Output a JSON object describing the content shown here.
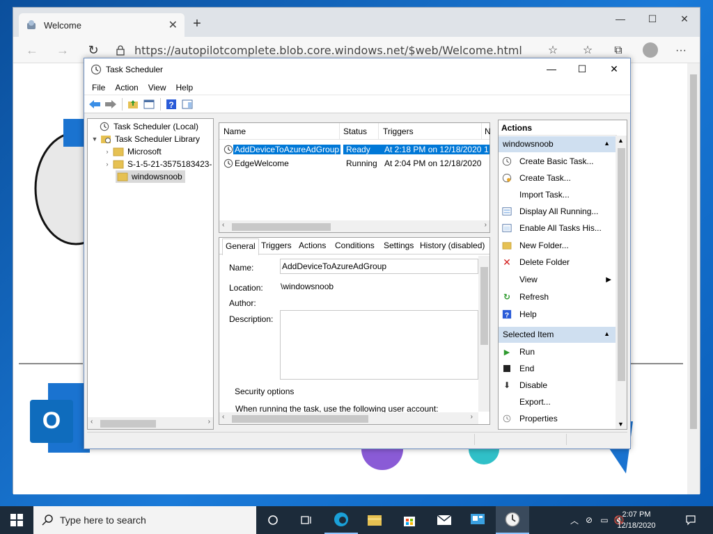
{
  "browser": {
    "tab_title": "Welcome",
    "url": "https://autopilotcomplete.blob.core.windows.net/$web/Welcome.html"
  },
  "task_scheduler": {
    "title": "Task Scheduler",
    "menu": [
      "File",
      "Action",
      "View",
      "Help"
    ],
    "tree": {
      "root": "Task Scheduler (Local)",
      "library": "Task Scheduler Library",
      "children": [
        "Microsoft",
        "S-1-5-21-3575183423-",
        "windowsnoob"
      ]
    },
    "task_list": {
      "columns": [
        "Name",
        "Status",
        "Triggers",
        "N"
      ],
      "rows": [
        {
          "name": "AddDeviceToAzureAdGroup",
          "status": "Ready",
          "trigger": "At 2:18 PM on 12/18/2020",
          "extra": "1"
        },
        {
          "name": "EdgeWelcome",
          "status": "Running",
          "trigger": "At 2:04 PM on 12/18/2020",
          "extra": ""
        }
      ]
    },
    "details": {
      "tabs": [
        "General",
        "Triggers",
        "Actions",
        "Conditions",
        "Settings",
        "History (disabled)"
      ],
      "name_label": "Name:",
      "name_value": "AddDeviceToAzureAdGroup",
      "location_label": "Location:",
      "location_value": "\\windowsnoob",
      "author_label": "Author:",
      "description_label": "Description:",
      "security_label": "Security options",
      "security_text": "When running the task, use the following user account:"
    },
    "actions": {
      "header": "Actions",
      "group1": "windowsnoob",
      "group1_items": [
        "Create Basic Task...",
        "Create Task...",
        "Import Task...",
        "Display All Running...",
        "Enable All Tasks His...",
        "New Folder...",
        "Delete Folder",
        "View",
        "Refresh",
        "Help"
      ],
      "group2": "Selected Item",
      "group2_items": [
        "Run",
        "End",
        "Disable",
        "Export...",
        "Properties"
      ]
    }
  },
  "taskbar": {
    "search_placeholder": "Type here to search",
    "time": "2:07 PM",
    "date": "12/18/2020"
  },
  "colors": {
    "selection": "#0078d7",
    "group_header": "#cfdff0",
    "taskbar": "#1c2b3a"
  }
}
